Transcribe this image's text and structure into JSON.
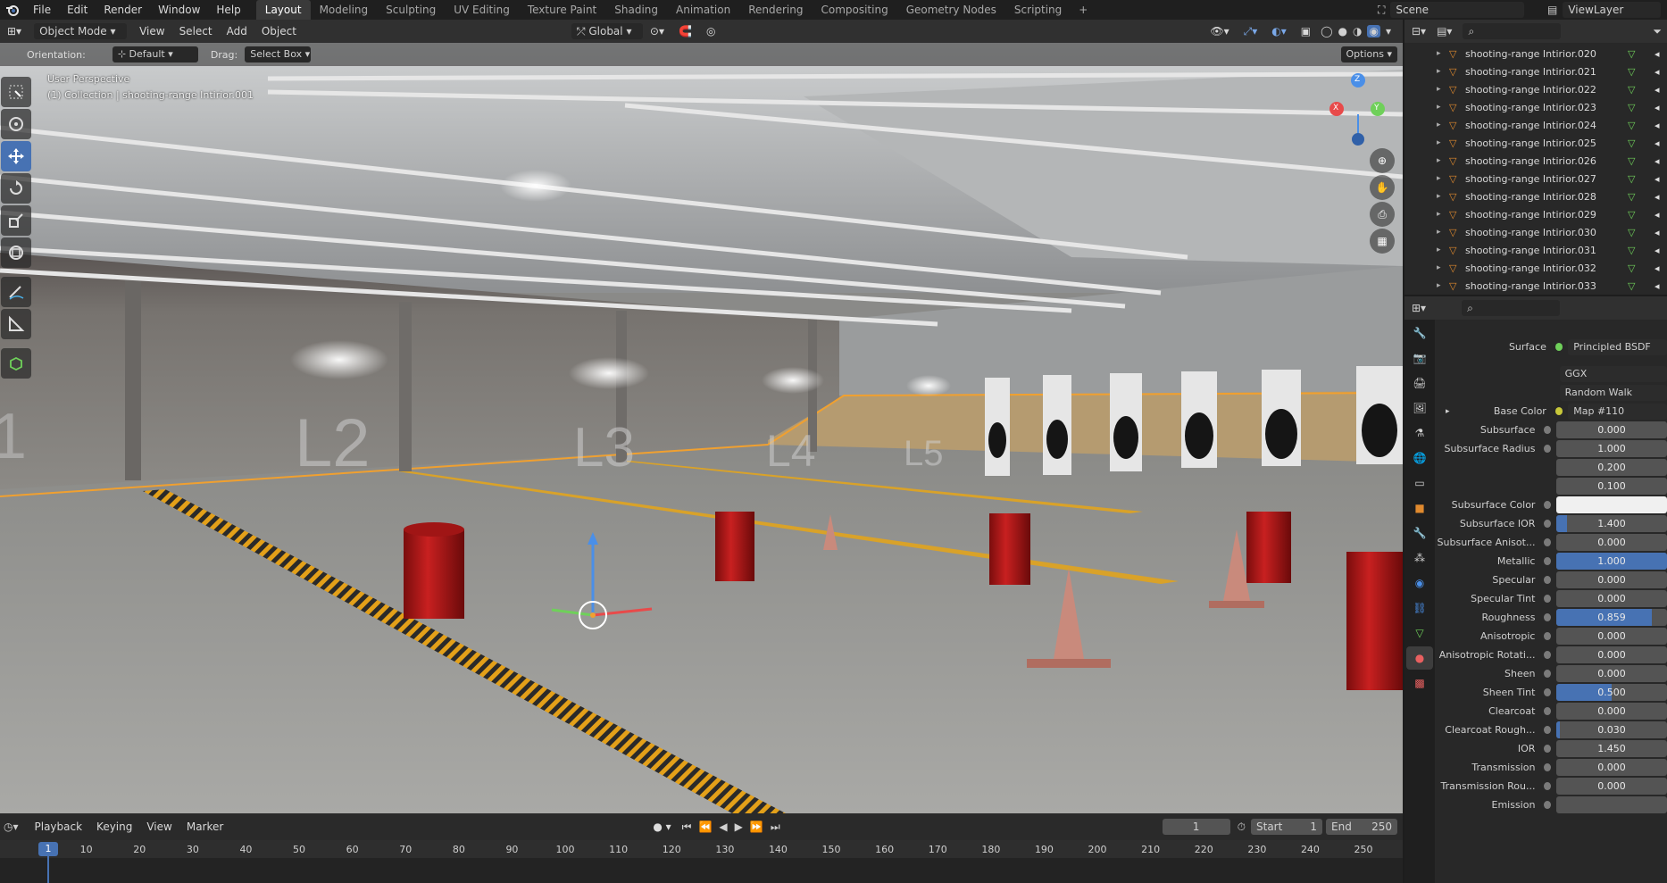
{
  "menu": [
    "File",
    "Edit",
    "Render",
    "Window",
    "Help"
  ],
  "workspaces": [
    "Layout",
    "Modeling",
    "Sculpting",
    "UV Editing",
    "Texture Paint",
    "Shading",
    "Animation",
    "Rendering",
    "Compositing",
    "Geometry Nodes",
    "Scripting"
  ],
  "active_workspace": "Layout",
  "scene_name": "Scene",
  "view_layer": "ViewLayer",
  "header": {
    "mode": "Object Mode",
    "menus": [
      "View",
      "Select",
      "Add",
      "Object"
    ],
    "transform_orientation": "Global"
  },
  "tool_options": {
    "orientation_label": "Orientation:",
    "orientation_value": "Default",
    "drag_label": "Drag:",
    "drag_value": "Select Box",
    "options_label": "Options"
  },
  "viewport": {
    "perspective": "User Perspective",
    "collection_info": "(1) Collection | shooting-range Intirior.001",
    "lane_labels": [
      "1",
      "L2",
      "L3",
      "L4",
      "L5"
    ],
    "gizmo_axes": [
      "Z",
      "X",
      "Y"
    ]
  },
  "tools": [
    "select-box",
    "cursor",
    "move",
    "rotate",
    "scale",
    "transform",
    "annotate",
    "measure",
    "add-cube"
  ],
  "outliner": {
    "items": [
      "shooting-range Intirior.020",
      "shooting-range Intirior.021",
      "shooting-range Intirior.022",
      "shooting-range Intirior.023",
      "shooting-range Intirior.024",
      "shooting-range Intirior.025",
      "shooting-range Intirior.026",
      "shooting-range Intirior.027",
      "shooting-range Intirior.028",
      "shooting-range Intirior.029",
      "shooting-range Intirior.030",
      "shooting-range Intirior.031",
      "shooting-range Intirior.032",
      "shooting-range Intirior.033"
    ]
  },
  "properties": {
    "surface_label": "Surface",
    "surface_value": "Principled BSDF",
    "distribution": "GGX",
    "subsurface_method": "Random Walk",
    "base_color_label": "Base Color",
    "base_color_value": "Map #110",
    "rows": [
      {
        "label": "Subsurface",
        "value": "0.000",
        "fill": 0
      },
      {
        "label": "Subsurface Radius",
        "value": "1.000",
        "fill": 0
      },
      {
        "label": "",
        "value": "0.200",
        "fill": 0
      },
      {
        "label": "",
        "value": "0.100",
        "fill": 0
      },
      {
        "label": "Subsurface Color",
        "value": "",
        "fill": 0,
        "swatch": "#f0f0f0"
      },
      {
        "label": "Subsurface IOR",
        "value": "1.400",
        "fill": 0.1
      },
      {
        "label": "Subsurface Anisot...",
        "value": "0.000",
        "fill": 0
      },
      {
        "label": "Metallic",
        "value": "1.000",
        "fill": 1
      },
      {
        "label": "Specular",
        "value": "0.000",
        "fill": 0
      },
      {
        "label": "Specular Tint",
        "value": "0.000",
        "fill": 0
      },
      {
        "label": "Roughness",
        "value": "0.859",
        "fill": 0.859
      },
      {
        "label": "Anisotropic",
        "value": "0.000",
        "fill": 0
      },
      {
        "label": "Anisotropic Rotati...",
        "value": "0.000",
        "fill": 0
      },
      {
        "label": "Sheen",
        "value": "0.000",
        "fill": 0
      },
      {
        "label": "Sheen Tint",
        "value": "0.500",
        "fill": 0.5
      },
      {
        "label": "Clearcoat",
        "value": "0.000",
        "fill": 0
      },
      {
        "label": "Clearcoat Rough...",
        "value": "0.030",
        "fill": 0.03
      },
      {
        "label": "IOR",
        "value": "1.450",
        "fill": 0
      },
      {
        "label": "Transmission",
        "value": "0.000",
        "fill": 0
      },
      {
        "label": "Transmission Rou...",
        "value": "0.000",
        "fill": 0
      },
      {
        "label": "Emission",
        "value": "",
        "fill": 0
      }
    ]
  },
  "timeline": {
    "menus": [
      "Playback",
      "Keying",
      "View",
      "Marker"
    ],
    "current_frame": "1",
    "start_label": "Start",
    "start_value": "1",
    "end_label": "End",
    "end_value": "250",
    "ticks": [
      "1",
      "10",
      "20",
      "30",
      "40",
      "50",
      "60",
      "70",
      "80",
      "90",
      "100",
      "110",
      "120",
      "130",
      "140",
      "150",
      "160",
      "170",
      "180",
      "190",
      "200",
      "210",
      "220",
      "230",
      "240",
      "250"
    ]
  },
  "colors": {
    "accent": "#4772b3",
    "selection_orange": "#f0a030",
    "barrel_red": "#b01818",
    "outliner_icon": "#e08a2e"
  }
}
